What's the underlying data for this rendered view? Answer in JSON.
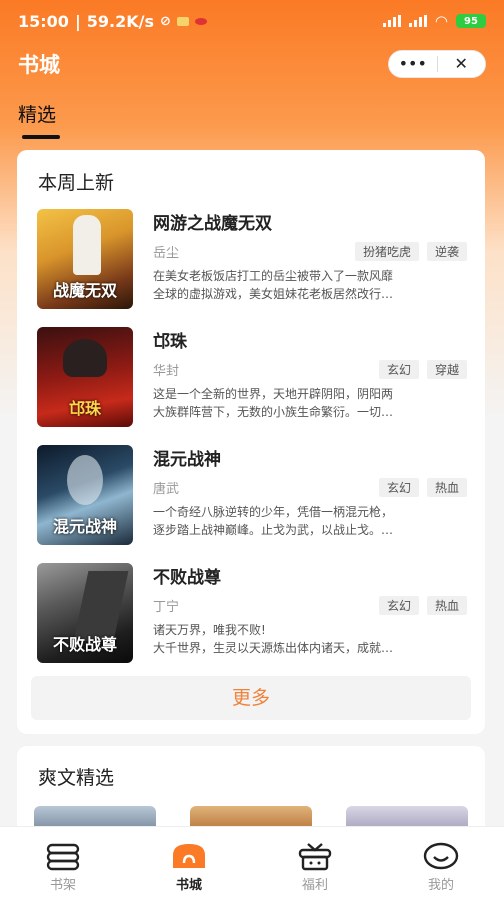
{
  "status_bar": {
    "time": "15:00",
    "speed": "59.2K/s",
    "battery": "95"
  },
  "header": {
    "title": "书城",
    "more_symbol": "•••",
    "close_symbol": "✕"
  },
  "tabs": [
    {
      "label": "精选",
      "active": true
    }
  ],
  "weekly_new": {
    "title": "本周上新",
    "books": [
      {
        "title": "网游之战魔无双",
        "author": "岳尘",
        "tags": [
          "扮猪吃虎",
          "逆袭"
        ],
        "desc_line1": "在美女老板饭店打工的岳尘被带入了一款风靡",
        "desc_line2": "全球的虚拟游戏，美女姐妹花老板居然改行…",
        "cover_text": "战魔无双"
      },
      {
        "title": "邙珠",
        "author": "华封",
        "tags": [
          "玄幻",
          "穿越"
        ],
        "desc_line1": "这是一个全新的世界，天地开辟阴阳，阴阳两",
        "desc_line2": "大族群阵营下，无数的小族生命繁衍。一切…",
        "cover_text": "邙珠"
      },
      {
        "title": "混元战神",
        "author": "唐武",
        "tags": [
          "玄幻",
          "热血"
        ],
        "desc_line1": "一个奇经八脉逆转的少年，凭借一柄混元枪，",
        "desc_line2": "逐步踏上战神巅峰。止戈为武，以战止戈。…",
        "cover_text": "混元战神"
      },
      {
        "title": "不败战尊",
        "author": "丁宁",
        "tags": [
          "玄幻",
          "热血"
        ],
        "desc_line1": "诸天万界，唯我不败!",
        "desc_line2": "大千世界，生灵以天源炼出体内诸天，成就…",
        "cover_text": "不败战尊"
      }
    ],
    "more_label": "更多"
  },
  "cool_picks": {
    "title": "爽文精选"
  },
  "bottom_nav": [
    {
      "label": "书架",
      "icon": "bookshelf-icon",
      "active": false
    },
    {
      "label": "书城",
      "icon": "bookstore-icon",
      "active": true
    },
    {
      "label": "福利",
      "icon": "gift-icon",
      "active": false
    },
    {
      "label": "我的",
      "icon": "profile-icon",
      "active": false
    }
  ],
  "colors": {
    "brand_orange": "#fb7a25",
    "more_text": "#f0823a"
  }
}
